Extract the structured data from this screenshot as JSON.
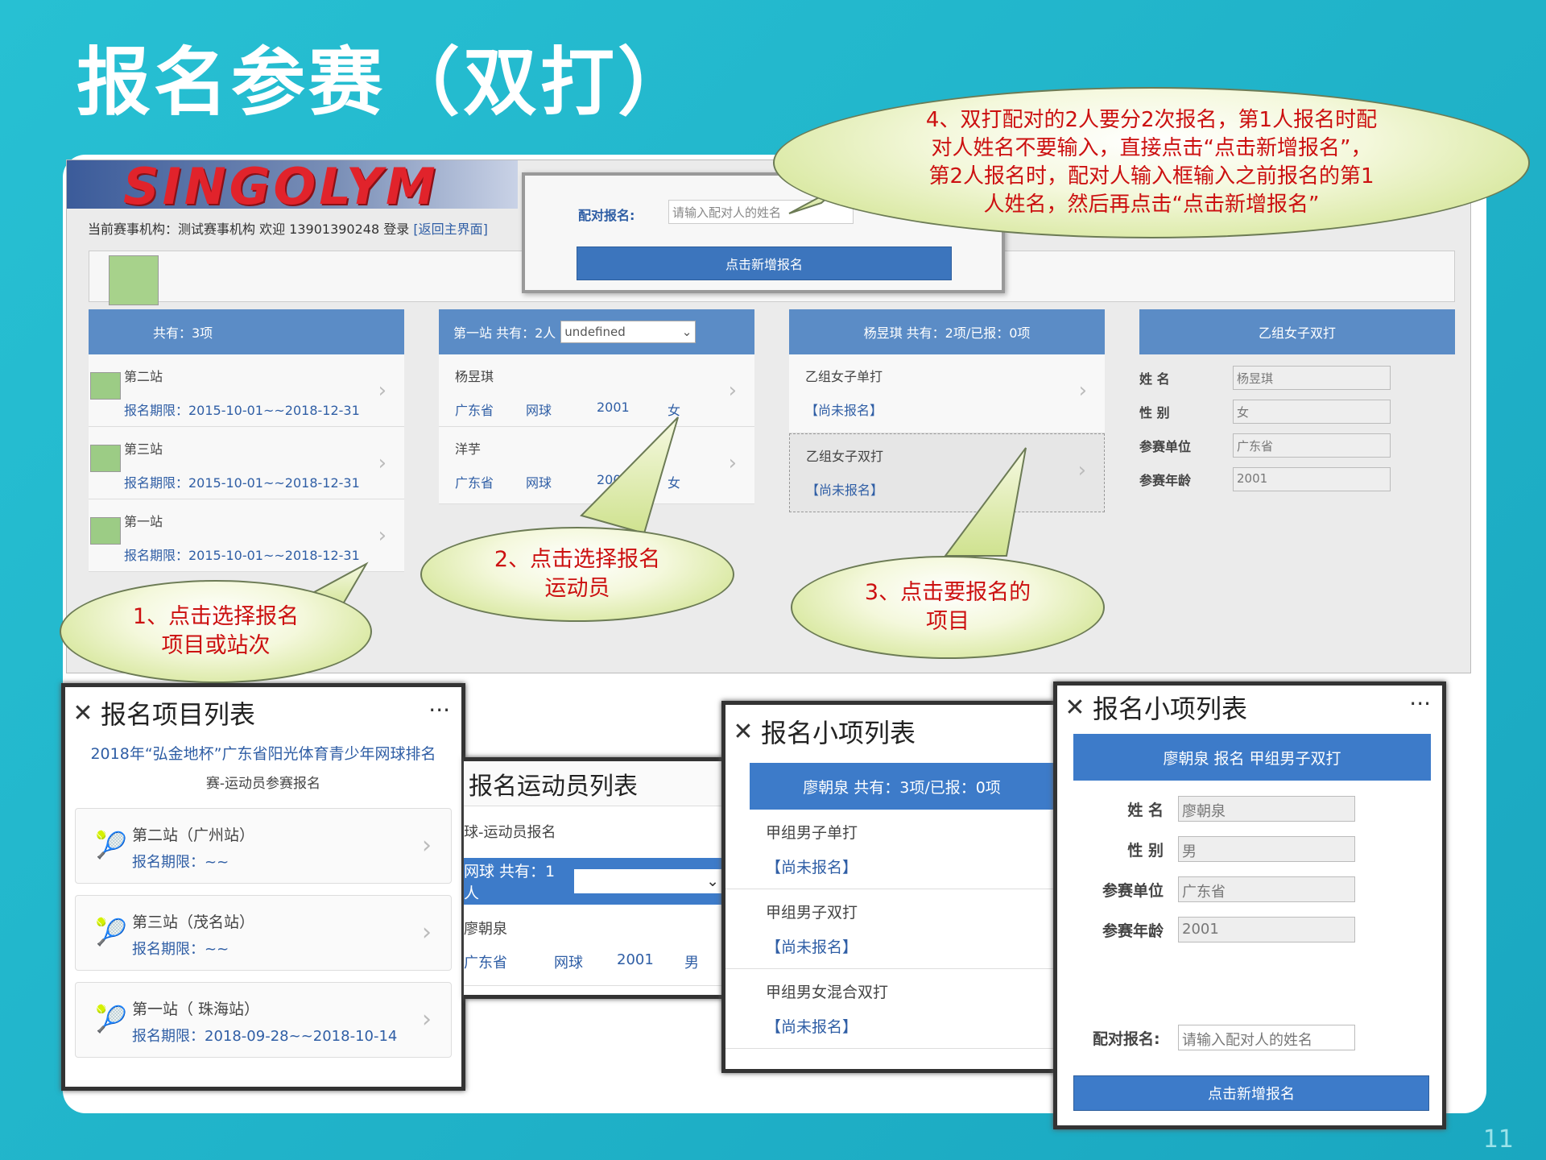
{
  "slide": {
    "title": "报名参赛（双打）",
    "page_num": "11"
  },
  "pc": {
    "logo": "SINGOLYM",
    "header_info": "当前赛事机构：测试赛事机构 欢迎 13901390248 登录",
    "back_link": "[返回主界面]",
    "col1": {
      "head": "共有：3项",
      "items": [
        {
          "name": "第二站",
          "period": "报名期限：2015-10-01~~2018-12-31"
        },
        {
          "name": "第三站",
          "period": "报名期限：2015-10-01~~2018-12-31"
        },
        {
          "name": "第一站",
          "period": "报名期限：2015-10-01~~2018-12-31"
        }
      ]
    },
    "col2": {
      "head": "第一站 共有：2人",
      "select": "undefined",
      "items": [
        {
          "name": "杨昱琪",
          "prov": "广东省",
          "sport": "网球",
          "year": "2001",
          "sex": "女"
        },
        {
          "name": "洋芋",
          "prov": "广东省",
          "sport": "网球",
          "year": "2001",
          "sex": "女"
        }
      ]
    },
    "col3": {
      "head": "杨昱琪 共有：2项/已报：0项",
      "items": [
        {
          "name": "乙组女子单打",
          "status": "【尚未报名】"
        },
        {
          "name": "乙组女子双打",
          "status": "【尚未报名】"
        }
      ]
    },
    "col4": {
      "head": "乙组女子双打",
      "fields": [
        {
          "label": "姓 名",
          "value": "杨昱琪"
        },
        {
          "label": "性 别",
          "value": "女"
        },
        {
          "label": "参赛单位",
          "value": "广东省"
        },
        {
          "label": "参赛年龄",
          "value": "2001"
        }
      ]
    },
    "popup": {
      "label": "配对报名:",
      "placeholder": "请输入配对人的姓名",
      "button": "点击新增报名"
    }
  },
  "bubbles": {
    "b1": "1、点击选择报名\n项目或站次",
    "b2": "2、点击选择报名\n运动员",
    "b3": "3、点击要报名的\n项目",
    "b4": "4、双打配对的2人要分2次报名，第1人报名时配\n对人姓名不要输入，直接点击“点击新增报名”，\n第2人报名时，配对人输入框输入之前报名的第1\n人姓名，然后再点击“点击新增报名”"
  },
  "mobile": {
    "m1": {
      "title": "报名项目列表",
      "event": "2018年“弘金地杯”广东省阳光体育青少年网球排名",
      "event2": "赛-运动员参赛报名",
      "items": [
        {
          "name": "第二站（广州站）",
          "period": "报名期限：~~"
        },
        {
          "name": "第三站（茂名站）",
          "period": "报名期限：~~"
        },
        {
          "name": "第一站（ 珠海站）",
          "period": "报名期限：2018-09-28~~2018-10-14"
        }
      ]
    },
    "m2": {
      "title": "报名运动员列表",
      "sub": "球-运动员报名",
      "bar": "网球 共有：1人",
      "item": {
        "name": "廖朝泉",
        "prov": "广东省",
        "sport": "网球",
        "year": "2001",
        "sex": "男"
      }
    },
    "m3": {
      "title": "报名小项列表",
      "bar": "廖朝泉 共有：3项/已报：0项",
      "items": [
        {
          "name": "甲组男子单打",
          "status": "【尚未报名】"
        },
        {
          "name": "甲组男子双打",
          "status": "【尚未报名】"
        },
        {
          "name": "甲组男女混合双打",
          "status": "【尚未报名】"
        }
      ]
    },
    "m4": {
      "title": "报名小项列表",
      "bar": "廖朝泉 报名 甲组男子双打",
      "fields": [
        {
          "label": "姓 名",
          "value": "廖朝泉"
        },
        {
          "label": "性 别",
          "value": "男"
        },
        {
          "label": "参赛单位",
          "value": "广东省"
        },
        {
          "label": "参赛年龄",
          "value": "2001"
        }
      ],
      "pair_label": "配对报名:",
      "pair_placeholder": "请输入配对人的姓名",
      "button": "点击新增报名"
    }
  }
}
